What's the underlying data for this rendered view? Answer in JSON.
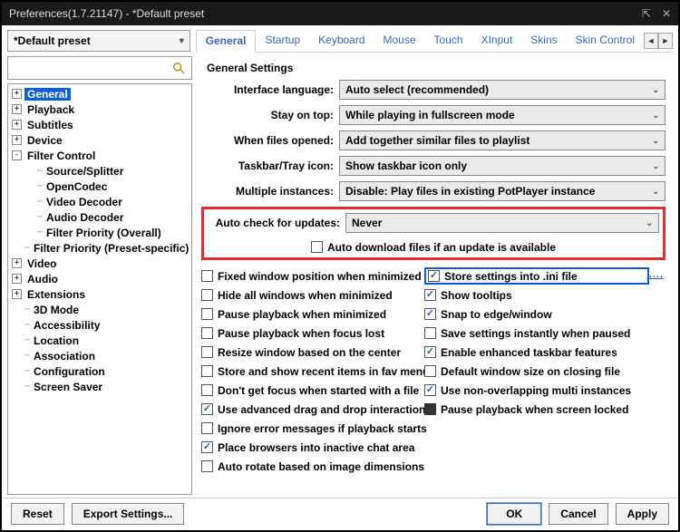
{
  "window": {
    "title": "Preferences(1.7.21147) - *Default preset"
  },
  "preset": {
    "value": "*Default preset"
  },
  "tabs": {
    "items": [
      "General",
      "Startup",
      "Keyboard",
      "Mouse",
      "Touch",
      "XInput",
      "Skins",
      "Skin Control"
    ],
    "active": 0
  },
  "tree": [
    {
      "label": "General",
      "expand": "+",
      "selected": true,
      "bold": true
    },
    {
      "label": "Playback",
      "expand": "+",
      "bold": true
    },
    {
      "label": "Subtitles",
      "expand": "+",
      "bold": true
    },
    {
      "label": "Device",
      "expand": "+",
      "bold": true
    },
    {
      "label": "Filter Control",
      "expand": "-",
      "bold": true,
      "children": [
        {
          "label": "Source/Splitter"
        },
        {
          "label": "OpenCodec"
        },
        {
          "label": "Video Decoder"
        },
        {
          "label": "Audio Decoder"
        },
        {
          "label": "Filter Priority (Overall)"
        },
        {
          "label": "Filter Priority (Preset-specific)"
        }
      ]
    },
    {
      "label": "Video",
      "expand": "+",
      "bold": true
    },
    {
      "label": "Audio",
      "expand": "+",
      "bold": true
    },
    {
      "label": "Extensions",
      "expand": "+",
      "bold": true
    },
    {
      "label": "3D Mode",
      "leaf": true,
      "bold": true
    },
    {
      "label": "Accessibility",
      "leaf": true,
      "bold": true
    },
    {
      "label": "Location",
      "leaf": true,
      "bold": true
    },
    {
      "label": "Association",
      "leaf": true,
      "bold": true
    },
    {
      "label": "Configuration",
      "leaf": true,
      "bold": true
    },
    {
      "label": "Screen Saver",
      "leaf": true,
      "bold": true
    }
  ],
  "section": {
    "title": "General Settings"
  },
  "settings": {
    "interface_language": {
      "label": "Interface language:",
      "value": "Auto select (recommended)"
    },
    "stay_on_top": {
      "label": "Stay on top:",
      "value": "While playing in fullscreen mode"
    },
    "when_files_opened": {
      "label": "When files opened:",
      "value": "Add together similar files to playlist"
    },
    "taskbar_icon": {
      "label": "Taskbar/Tray icon:",
      "value": "Show taskbar icon only"
    },
    "multiple_instances": {
      "label": "Multiple instances:",
      "value": "Disable: Play files in existing PotPlayer instance"
    },
    "auto_check": {
      "label": "Auto check for updates:",
      "value": "Never"
    },
    "auto_dl": {
      "label": "Auto download files if an update is available",
      "checked": false
    }
  },
  "checks_left": [
    {
      "label": "Fixed window position when minimized",
      "checked": false
    },
    {
      "label": "Hide all windows when minimized",
      "checked": false
    },
    {
      "label": "Pause playback when minimized",
      "checked": false
    },
    {
      "label": "Pause playback when focus lost",
      "checked": false
    },
    {
      "label": "Resize window based on the center",
      "checked": false
    },
    {
      "label": "Store and show recent items in fav menu",
      "checked": false
    },
    {
      "label": "Don't get focus when started with a file",
      "checked": false
    },
    {
      "label": "Use advanced drag and drop interaction",
      "checked": true
    },
    {
      "label": "Ignore error messages if playback starts",
      "checked": false
    },
    {
      "label": "Place browsers into inactive chat area",
      "checked": true
    },
    {
      "label": "Auto rotate based on image dimensions",
      "checked": false
    }
  ],
  "checks_right": [
    {
      "label": "Store settings into .ini file",
      "checked": true,
      "highlight": true
    },
    {
      "label": "Show tooltips",
      "checked": true
    },
    {
      "label": "Snap to edge/window",
      "checked": true
    },
    {
      "label": "Save settings instantly when paused",
      "checked": false
    },
    {
      "label": "Enable enhanced taskbar features",
      "checked": true
    },
    {
      "label": "Default window size on closing file",
      "checked": false
    },
    {
      "label": "Use non-overlapping multi instances",
      "checked": true
    },
    {
      "label": "Pause playback when screen locked",
      "checked": false,
      "filled": true
    }
  ],
  "more": "....",
  "buttons": {
    "reset": "Reset",
    "export": "Export Settings...",
    "ok": "OK",
    "cancel": "Cancel",
    "apply": "Apply"
  }
}
